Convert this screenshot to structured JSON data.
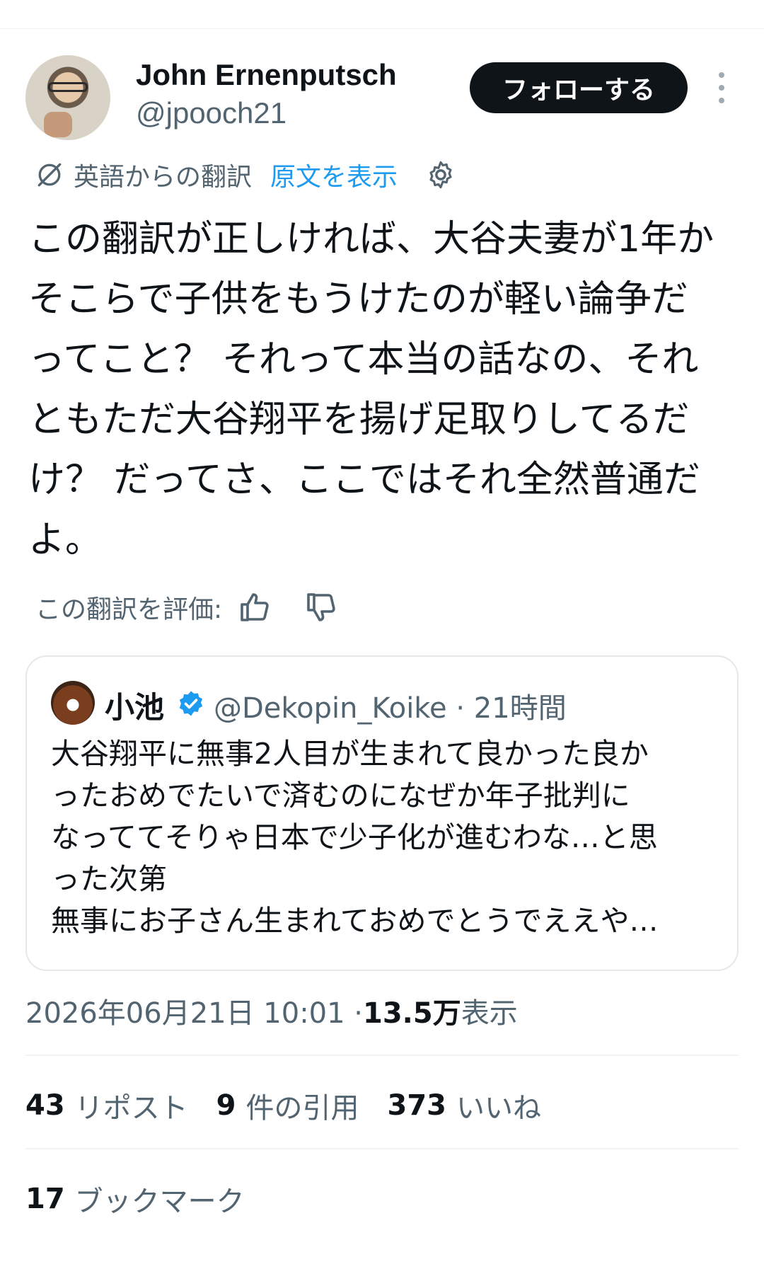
{
  "author": {
    "name": "John Ernenputsch",
    "handle": "@jpooch21",
    "follow_label": "フォローする"
  },
  "translation": {
    "label": "英語からの翻訳",
    "show_original": "原文を表示",
    "rate_label": "この翻訳を評価:"
  },
  "tweet": {
    "text": "この翻訳が正しければ、大谷夫妻が1年か\nそこらで子供をもうけたのが軽い論争だ\nってこと？ それって本当の話なの、それ\nともただ大谷翔平を揚げ足取りしてるだ\nけ？ だってさ、ここではそれ全然普通だ\nよ。"
  },
  "quote": {
    "name": "小池",
    "meta": "@Dekopin_Koike · 21時間",
    "text": "大谷翔平に無事2人目が生まれて良かった良か\nったおめでたいで済むのになぜか年子批判に\nなっててそりゃ日本で少子化が進むわな…と思\nった次第\n無事にお子さん生まれておめでとうでええや…",
    "verified_color": "#1d9bf0"
  },
  "meta": {
    "timestamp": "2026年06月21日 10:01 · ",
    "views_count": "13.5万",
    "views_label": " 表示"
  },
  "stats": {
    "reposts_count": "43",
    "reposts_label": "リポスト",
    "quotes_count": "9",
    "quotes_label": "件の引用",
    "likes_count": "373",
    "likes_label": "いいね",
    "bookmarks_count": "17",
    "bookmarks_label": "ブックマーク"
  },
  "icons": {
    "translate": "translate-icon",
    "settings": "gear-icon",
    "thumb_up": "thumbs-up-icon",
    "thumb_down": "thumbs-down-icon",
    "more": "more-vertical-icon",
    "verified": "verified-badge-icon"
  },
  "colors": {
    "link": "#1d9bf0",
    "text": "#0f1419",
    "muted": "#536471",
    "follow_bg": "#0f1419"
  }
}
